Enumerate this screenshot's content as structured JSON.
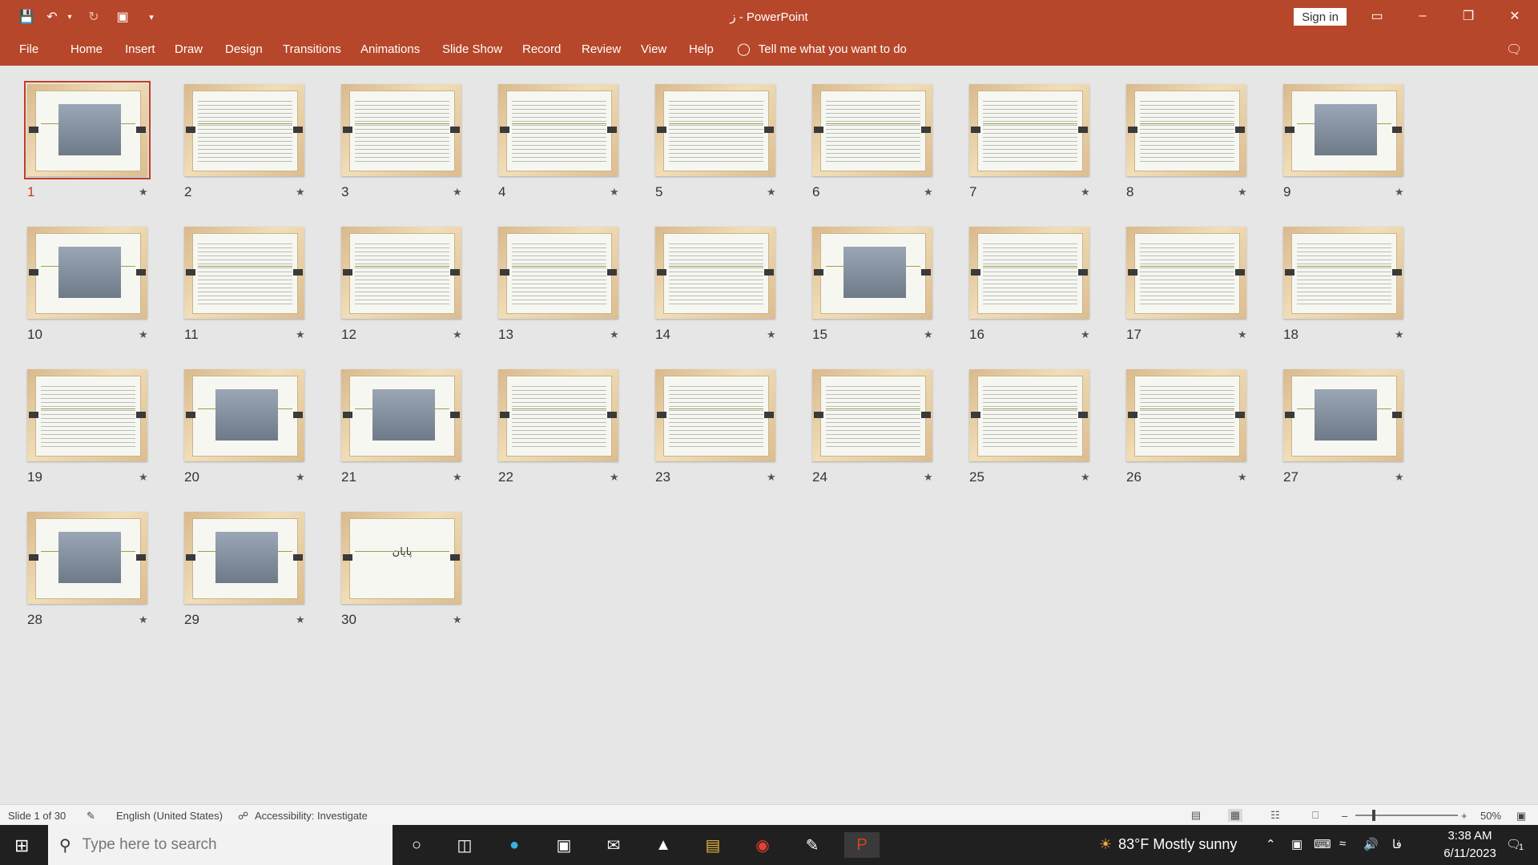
{
  "titlebar": {
    "title": "ز  -  PowerPoint",
    "sign_in": "Sign in",
    "quick_access": [
      "save-icon",
      "undo-icon",
      "redo-icon",
      "presentation-icon",
      "customize-icon"
    ]
  },
  "ribbon": {
    "tabs": [
      "File",
      "Home",
      "Insert",
      "Draw",
      "Design",
      "Transitions",
      "Animations",
      "Slide Show",
      "Record",
      "Review",
      "View",
      "Help"
    ],
    "tell_me": "Tell me what you want to do"
  },
  "slides": {
    "selected": 1,
    "items": [
      {
        "number": "1",
        "kind": "image",
        "star": "★"
      },
      {
        "number": "2",
        "kind": "text",
        "star": "★"
      },
      {
        "number": "3",
        "kind": "text",
        "star": "★"
      },
      {
        "number": "4",
        "kind": "text",
        "star": "★"
      },
      {
        "number": "5",
        "kind": "text",
        "star": "★"
      },
      {
        "number": "6",
        "kind": "text",
        "star": "★"
      },
      {
        "number": "7",
        "kind": "text",
        "star": "★"
      },
      {
        "number": "8",
        "kind": "text",
        "star": "★"
      },
      {
        "number": "9",
        "kind": "image",
        "star": "★"
      },
      {
        "number": "10",
        "kind": "image",
        "star": "★"
      },
      {
        "number": "11",
        "kind": "text",
        "star": "★"
      },
      {
        "number": "12",
        "kind": "text",
        "star": "★"
      },
      {
        "number": "13",
        "kind": "text",
        "star": "★"
      },
      {
        "number": "14",
        "kind": "text",
        "star": "★"
      },
      {
        "number": "15",
        "kind": "image",
        "star": "★"
      },
      {
        "number": "16",
        "kind": "text",
        "star": "★"
      },
      {
        "number": "17",
        "kind": "text",
        "star": "★"
      },
      {
        "number": "18",
        "kind": "text",
        "star": "★"
      },
      {
        "number": "19",
        "kind": "text",
        "star": "★"
      },
      {
        "number": "20",
        "kind": "image",
        "star": "★"
      },
      {
        "number": "21",
        "kind": "image",
        "star": "★"
      },
      {
        "number": "22",
        "kind": "text",
        "star": "★"
      },
      {
        "number": "23",
        "kind": "text",
        "star": "★"
      },
      {
        "number": "24",
        "kind": "text",
        "star": "★"
      },
      {
        "number": "25",
        "kind": "text",
        "star": "★"
      },
      {
        "number": "26",
        "kind": "text",
        "star": "★"
      },
      {
        "number": "27",
        "kind": "image",
        "star": "★"
      },
      {
        "number": "28",
        "kind": "image",
        "star": "★"
      },
      {
        "number": "29",
        "kind": "image",
        "star": "★"
      },
      {
        "number": "30",
        "kind": "title",
        "title": "پایان",
        "star": "★"
      }
    ]
  },
  "statusbar": {
    "slide_info": "Slide 1 of 30",
    "language": "English (United States)",
    "accessibility": "Accessibility: Investigate",
    "zoom": "50%"
  },
  "taskbar": {
    "search_placeholder": "Type here to search",
    "weather": "83°F  Mostly sunny",
    "time": "3:38 AM",
    "date": "6/11/2023",
    "lang": "فا",
    "notifications": "1"
  },
  "colors": {
    "accent": "#b7472a",
    "selection": "#c43e1c",
    "taskbar": "#202020"
  }
}
